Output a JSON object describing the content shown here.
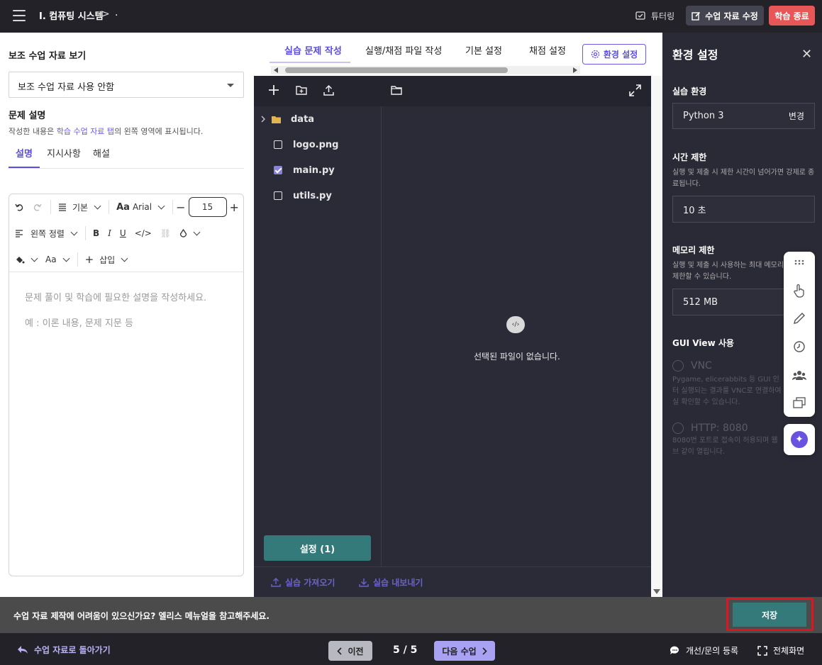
{
  "topbar": {
    "breadcrumb": "I. 컴퓨팅 시스템",
    "breadcrumb_sep": ">",
    "breadcrumb_current": ".",
    "tutoring_label": "튜터링",
    "edit_material_label": "수업 자료 수정",
    "end_learning_label": "학습 종료"
  },
  "left": {
    "aux_heading": "보조 수업 자료 보기",
    "aux_select_value": "보조 수업 자료 사용 안함",
    "desc_heading": "문제 설명",
    "desc_note_pre": "작성한 내용은 ",
    "desc_note_link": "학습 수업 자료 탭",
    "desc_note_post": "의 왼쪽 영역에 표시됩니다.",
    "tabs": [
      "설명",
      "지시사항",
      "해설"
    ],
    "toolbar": {
      "paragraph_style": "기본",
      "font_family": "Arial",
      "font_size": "15",
      "align": "왼쪽 정렬",
      "insert": "삽입"
    },
    "placeholder_line1": "문제 풀이 및 학습에 필요한 설명을 작성하세요.",
    "placeholder_line2": "예 : 이론 내용, 문제 지문 등"
  },
  "middle": {
    "tabs": [
      "실습 문제 작성",
      "실행/채점 파일 작성",
      "기본 설정",
      "채점 설정"
    ],
    "env_button": "환경 설정",
    "files": [
      {
        "name": "data",
        "type": "folder"
      },
      {
        "name": "logo.png",
        "checked": false
      },
      {
        "name": "main.py",
        "checked": true
      },
      {
        "name": "utils.py",
        "checked": false
      }
    ],
    "settings_button": "설정 (1)",
    "empty_message": "선택된 파일이 없습니다.",
    "import_label": "실습 가져오기",
    "export_label": "실습 내보내기"
  },
  "right": {
    "title": "환경 설정",
    "env_heading": "실습 환경",
    "env_value": "Python 3",
    "env_change": "변경",
    "time_heading": "시간 제한",
    "time_note": "실행 및 제출 시 제한 시간이 넘어가면 강제로 종료됩니다.",
    "time_value": "10 초",
    "mem_heading": "메모리 제한",
    "mem_note": "실행 및 제출 시 사용하는 최대 메모리 제한할 수 있습니다.",
    "mem_value": "512 MB",
    "gui_heading": "GUI View 사용",
    "vnc_label": "VNC",
    "vnc_note": "Pygame, elicerabbits 등 GUI 인터 실행되는 결과를 VNC로 연결하여 실 확인할 수 있습니다.",
    "http_label": "HTTP: 8080",
    "http_note": "8080번 포트로 접속이 허용되며 웹 브 같이 열립니다."
  },
  "helpbar": {
    "text": "수업 자료 제작에 어려움이 있으신가요? 엘리스 메뉴얼을 참고해주세요.",
    "save_label": "저장"
  },
  "navbar": {
    "back_label": "수업 자료로 돌아가기",
    "prev_label": "이전",
    "page_indicator": "5 / 5",
    "next_label": "다음 수업",
    "inquiry_label": "개선/문의 등록",
    "fullscreen_label": "전체화면"
  }
}
